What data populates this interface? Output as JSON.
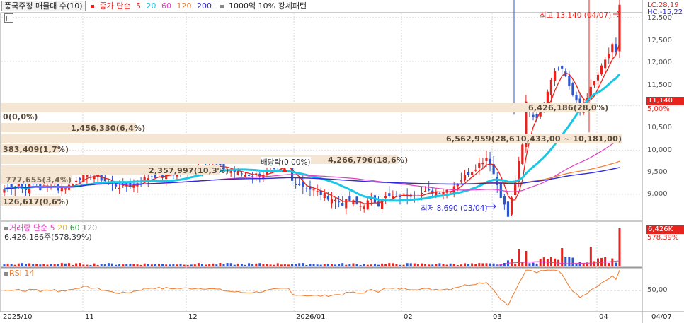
{
  "header": {
    "title": "풍국주정 매물대 수(10)",
    "ma_label": "종가 단순",
    "ma_periods": [
      "5",
      "20",
      "60",
      "120",
      "200"
    ],
    "ma_colors": [
      "#e8231d",
      "#19c8e6",
      "#e040c0",
      "#f07a2a",
      "#2d2ae0"
    ],
    "pattern": "1000억 10% 강세패턴"
  },
  "chart_data": [
    {
      "type": "candlestick",
      "ylim": [
        8500,
        13200
      ],
      "y_ticks": [
        "12,500",
        "12,000",
        "11,500",
        "11,000",
        "10,500",
        "10,000",
        "9,500",
        "9,000"
      ],
      "x_ticks": [
        "2025/10",
        "11",
        "12",
        "2026/01",
        "02",
        "03",
        "04",
        "04/07"
      ],
      "price_labels": {
        "lc": "LC:28,19",
        "hc": "HC:-15,22"
      },
      "last_close_tag": "11,140",
      "last_close_pct": "5,00%",
      "annotations": {
        "high": "최고 13,140 (04/07)",
        "low": "최저 8,690 (03/04)",
        "dividend": "배당락(0,00%)"
      },
      "volume_profile": [
        "0(0,0%)",
        "1,456,330(6,4%)",
        "383,409(1,7%)",
        "2,357,997(10,3%)",
        "4,266,796(18,6%)",
        "6,426,186(28,0%)",
        "6,562,959(28,6%)",
        "777,655(3,4%)",
        "126,617(0,6%)",
        "10,433,00 ~ 10,181,00)"
      ]
    },
    {
      "type": "bar",
      "title": "거래량 단순",
      "periods": [
        "5",
        "20",
        "60",
        "120"
      ],
      "value_text": "6,426,186주(578,39%)",
      "tag": "6,426K",
      "tag_pct": "578,39%"
    },
    {
      "type": "line",
      "title": "RSI 14",
      "tick": "50,00"
    }
  ]
}
